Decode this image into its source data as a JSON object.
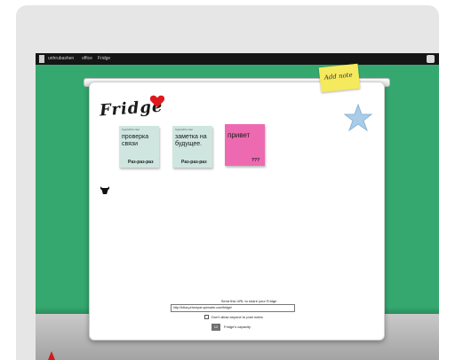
{
  "topbar": {
    "links": [
      "unhrubashen",
      "office",
      "Fridge"
    ],
    "right_text": "",
    "menu_icon": "menu-icon",
    "account_icon": "user-icon"
  },
  "fridge": {
    "logo": "Fridge",
    "add_note_label": "Add note",
    "notes": [
      {
        "meta": "Сделайте сам",
        "text": "проверка связи",
        "sign": "Рaз-paз-paз",
        "color": "#cfe6e0"
      },
      {
        "meta": "Сделайте сам",
        "text": "заметка на будущее.",
        "sign": "Рaз-paз-paз",
        "color": "#cfe6e0"
      },
      {
        "meta": "",
        "text": "привет",
        "sign": "???",
        "color": "#ee6ab0"
      }
    ]
  },
  "share": {
    "label": "Send this URL to share your Fridge",
    "url": "http://kltus.privenpar.spenarte.com/fridge/",
    "checkbox_label": "Don't allow anyone to post notes",
    "capacity_value": "12",
    "capacity_label": "Fridge's capacity"
  },
  "colors": {
    "background": "#34a86e",
    "note_mint": "#cfe6e0",
    "note_pink": "#ee6ab0",
    "note_yellow": "#f5e95e"
  }
}
